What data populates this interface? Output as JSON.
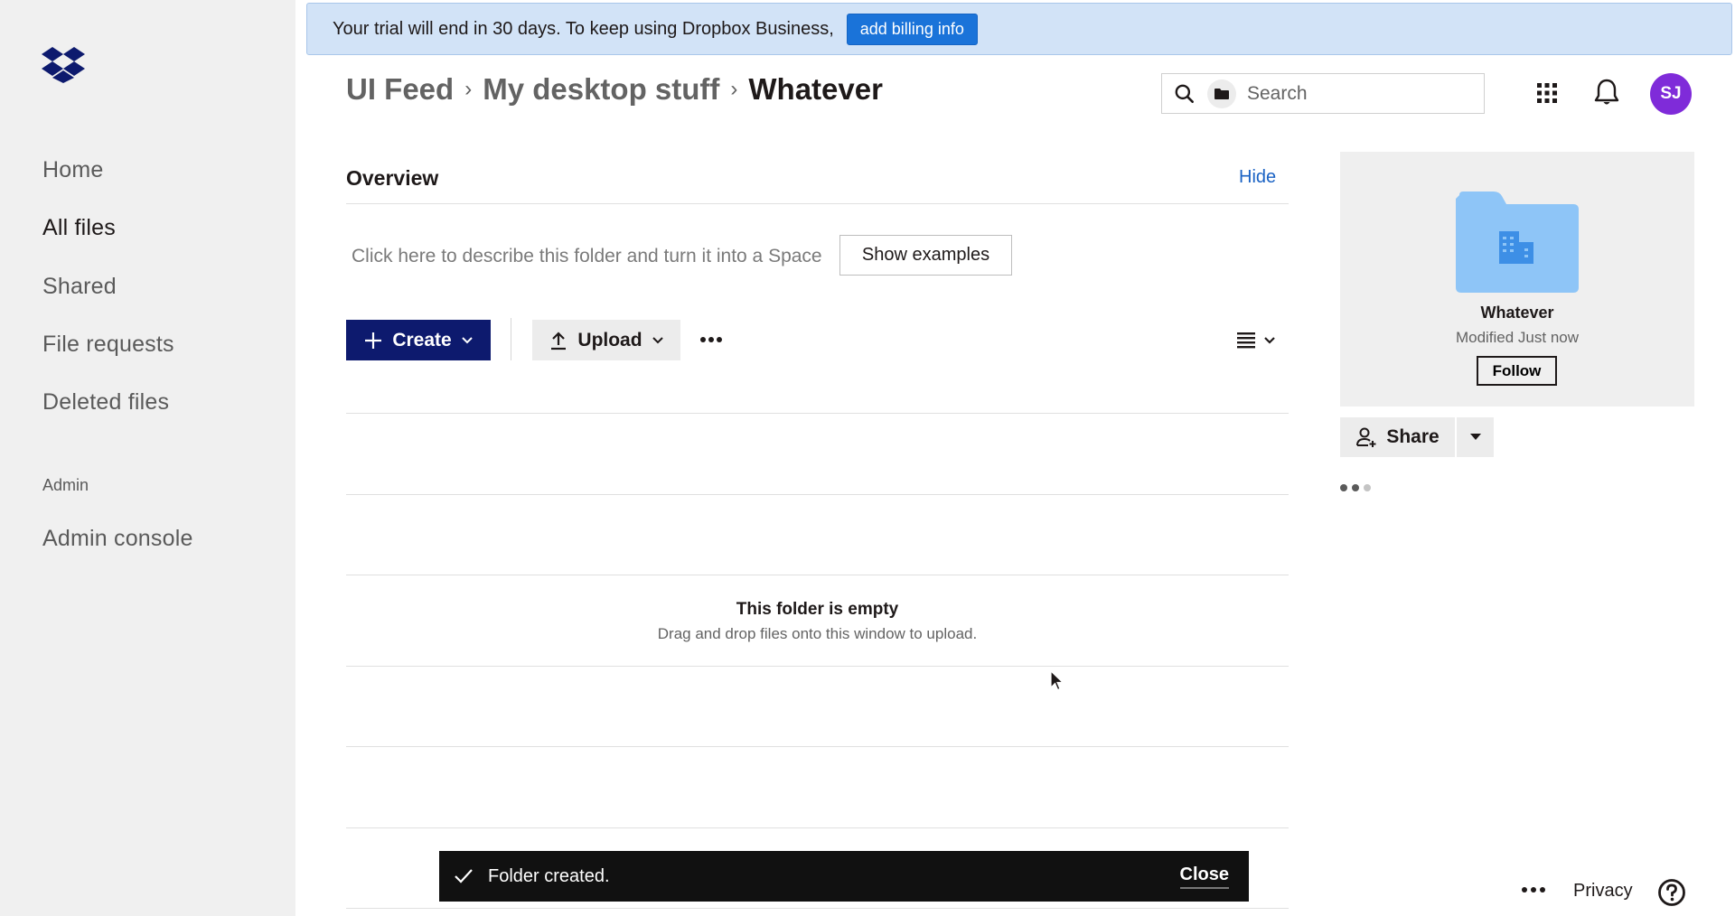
{
  "sidebar": {
    "logo": "dropbox-logo",
    "items": [
      {
        "label": "Home",
        "active": false
      },
      {
        "label": "All files",
        "active": true
      },
      {
        "label": "Shared",
        "active": false
      },
      {
        "label": "File requests",
        "active": false
      },
      {
        "label": "Deleted files",
        "active": false
      }
    ],
    "admin_section": {
      "heading": "Admin",
      "items": [
        {
          "label": "Admin console"
        }
      ]
    }
  },
  "banner": {
    "text": "Your trial will end in 30 days. To keep using Dropbox Business,",
    "button_label": "add billing info",
    "background": "#d2e3f7",
    "button_color": "#1a73d9"
  },
  "breadcrumb": {
    "items": [
      "UI Feed",
      "My desktop stuff",
      "Whatever"
    ],
    "separator": "›"
  },
  "header": {
    "search_placeholder": "Search",
    "search_icon": "search-icon",
    "scope_icon": "folder-icon",
    "apps_icon": "grid-icon",
    "notifications_icon": "bell-icon",
    "avatar_initials": "SJ",
    "avatar_color": "#7f2bd9"
  },
  "overview": {
    "title": "Overview",
    "hide_label": "Hide",
    "describe_prompt": "Click here to describe this folder and turn it into a Space",
    "show_examples_label": "Show examples"
  },
  "toolbar": {
    "create_label": "Create",
    "upload_label": "Upload",
    "more_icon": "more-horizontal-icon",
    "view_icon": "list-view-icon",
    "create_color": "#0d1a6e"
  },
  "empty_state": {
    "title": "This folder is empty",
    "subtitle": "Drag and drop files onto this window to upload."
  },
  "toast": {
    "message": "Folder created.",
    "close_label": "Close"
  },
  "info_panel": {
    "folder_name": "Whatever",
    "modified": "Modified Just now",
    "follow_label": "Follow",
    "share_label": "Share",
    "folder_color": "#8ec5f7"
  },
  "footer": {
    "privacy_label": "Privacy",
    "help_icon": "help-icon"
  }
}
